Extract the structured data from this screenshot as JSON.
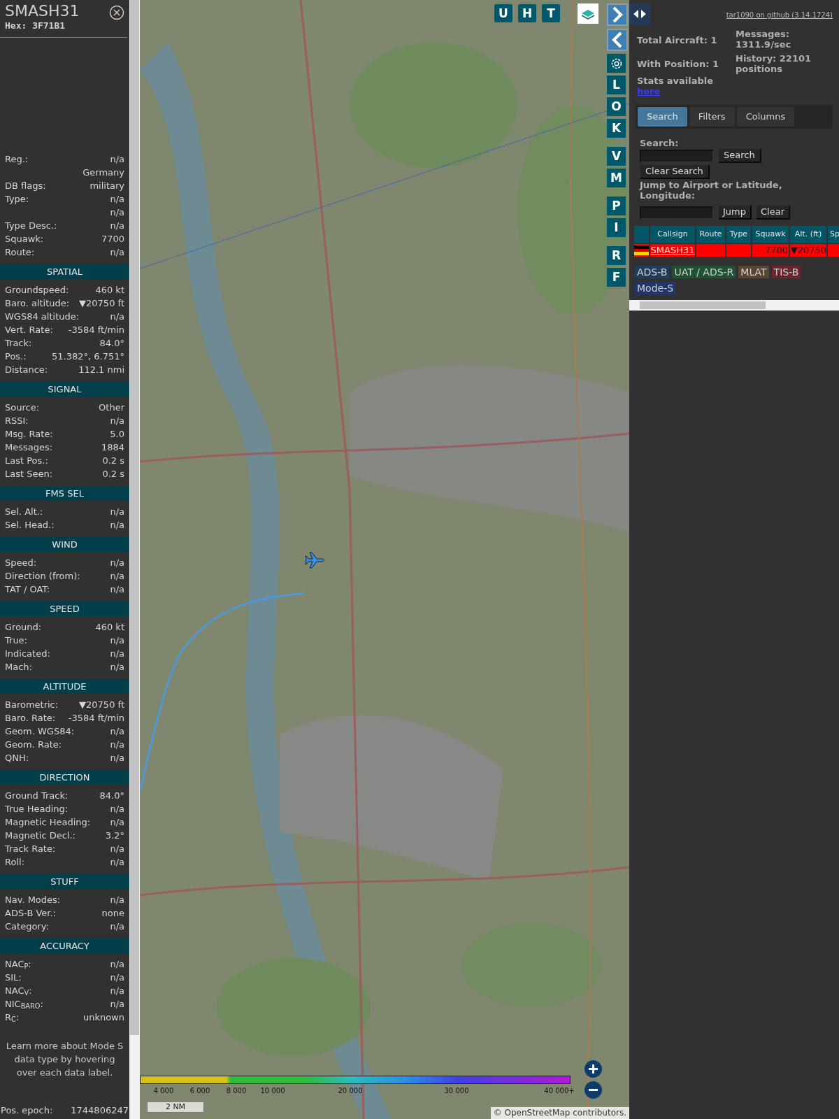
{
  "sidebar": {
    "title": "SMASH31",
    "hex": "Hex: 3F71B1",
    "sections": [
      {
        "rows": [
          {
            "label": "Reg.:",
            "value": "n/a"
          },
          {
            "value": "Germany"
          },
          {
            "label": "DB flags:",
            "value": "military"
          },
          {
            "label": "Type:",
            "value": "n/a"
          },
          {
            "value": "n/a"
          },
          {
            "label": "Type Desc.:",
            "value": "n/a"
          },
          {
            "label": "Squawk:",
            "value": "7700"
          },
          {
            "label": "Route:",
            "value": "n/a"
          }
        ]
      },
      {
        "heading": "SPATIAL",
        "rows": [
          {
            "label": "Groundspeed:",
            "value": "460 kt"
          },
          {
            "label": "Baro. altitude:",
            "value": "▼20750 ft"
          },
          {
            "label": "WGS84 altitude:",
            "value": "n/a"
          },
          {
            "label": "Vert. Rate:",
            "value": "-3584 ft/min"
          },
          {
            "label": "Track:",
            "value": "84.0°"
          },
          {
            "label": "Pos.:",
            "value": "51.382°, 6.751°"
          },
          {
            "label": "Distance:",
            "value": "112.1 nmi"
          }
        ]
      },
      {
        "heading": "SIGNAL",
        "rows": [
          {
            "label": "Source:",
            "value": "Other"
          },
          {
            "label": "RSSI:",
            "value": "n/a"
          },
          {
            "label": "Msg. Rate:",
            "value": "5.0"
          },
          {
            "label": "Messages:",
            "value": "1884"
          },
          {
            "label": "Last Pos.:",
            "value": "0.2 s"
          },
          {
            "label": "Last Seen:",
            "value": "0.2 s"
          }
        ]
      },
      {
        "heading": "FMS SEL",
        "rows": [
          {
            "label": "Sel. Alt.:",
            "value": "n/a"
          },
          {
            "label": "Sel. Head.:",
            "value": "n/a"
          }
        ]
      },
      {
        "heading": "WIND",
        "rows": [
          {
            "label": "Speed:",
            "value": "n/a"
          },
          {
            "label": "Direction (from):",
            "value": "n/a"
          },
          {
            "label": "TAT / OAT:",
            "value": "n/a"
          }
        ]
      },
      {
        "heading": "SPEED",
        "rows": [
          {
            "label": "Ground:",
            "value": "460 kt"
          },
          {
            "label": "True:",
            "value": "n/a"
          },
          {
            "label": "Indicated:",
            "value": "n/a"
          },
          {
            "label": "Mach:",
            "value": "n/a"
          }
        ]
      },
      {
        "heading": "ALTITUDE",
        "rows": [
          {
            "label": "Barometric:",
            "value": "▼20750 ft"
          },
          {
            "label": "Baro. Rate:",
            "value": "-3584 ft/min"
          },
          {
            "label": "Geom. WGS84:",
            "value": "n/a"
          },
          {
            "label": "Geom. Rate:",
            "value": "n/a"
          },
          {
            "label": "QNH:",
            "value": "n/a"
          }
        ]
      },
      {
        "heading": "DIRECTION",
        "rows": [
          {
            "label": "Ground Track:",
            "value": "84.0°"
          },
          {
            "label": "True Heading:",
            "value": "n/a"
          },
          {
            "label": "Magnetic Heading:",
            "value": "n/a"
          },
          {
            "label": "Magnetic Decl.:",
            "value": "3.2°"
          },
          {
            "label": "Track Rate:",
            "value": "n/a"
          },
          {
            "label": "Roll:",
            "value": "n/a"
          }
        ]
      },
      {
        "heading": "STUFF",
        "rows": [
          {
            "label": "Nav. Modes:",
            "value": "n/a"
          },
          {
            "label": "ADS-B Ver.:",
            "value": "none"
          },
          {
            "label": "Category:",
            "value": "n/a"
          }
        ]
      },
      {
        "heading": "ACCURACY",
        "rows": [
          {
            "label": "NAC$_{P}$:",
            "value": "n/a"
          },
          {
            "label": "SIL:",
            "value": "n/a"
          },
          {
            "label": "NAC$_{V}$:",
            "value": "n/a"
          },
          {
            "label": "NIC$_{BARO}$:",
            "value": "n/a"
          },
          {
            "label": "R$_{C}$:",
            "value": "unknown"
          }
        ]
      }
    ],
    "footnote": "Learn more about Mode S data type by hovering over each data label.",
    "epoch": {
      "label": "Pos. epoch:",
      "value": "1744806247"
    }
  },
  "map": {
    "top_buttons": [
      "U",
      "H",
      "T"
    ],
    "side_buttons": [
      {
        "kind": "next"
      },
      {
        "kind": "prev"
      },
      {
        "kind": "settings"
      },
      {
        "kind": "letter",
        "label": "L"
      },
      {
        "kind": "letter",
        "label": "O"
      },
      {
        "kind": "letter",
        "label": "K"
      },
      {
        "kind": "letter",
        "label": "V"
      },
      {
        "kind": "letter",
        "label": "M"
      },
      {
        "kind": "letter",
        "label": "P"
      },
      {
        "kind": "letter",
        "label": "I"
      },
      {
        "kind": "letter",
        "label": "R"
      },
      {
        "kind": "letter",
        "label": "F"
      }
    ],
    "legend": [
      "4 000",
      "6 000",
      "8 000",
      "10 000",
      "20 000",
      "30 000",
      "40 000+"
    ],
    "scale": "2 NM",
    "attribution": "© OpenStreetMap contributors."
  },
  "panel": {
    "github_link": "tar1090 on github (3.14.1724)",
    "stats": {
      "total": "Total Aircraft: 1",
      "with_position": "With Position: 1",
      "stats_label": "Stats available",
      "stats_link": "here",
      "messages": "Messages: 1311.9/sec",
      "history": "History: 22101 positions"
    },
    "tabs": [
      {
        "label": "Search",
        "selected": true
      },
      {
        "label": "Filters",
        "selected": false
      },
      {
        "label": "Columns",
        "selected": false
      }
    ],
    "search": {
      "label": "Search:",
      "button": "Search",
      "clear_button": "Clear Search"
    },
    "jump": {
      "label": "Jump to Airport or Latitude, Longitude:",
      "buttons": [
        "Jump",
        "Clear"
      ]
    },
    "table": {
      "columns": [
        "Callsign",
        "Route",
        "Type",
        "Squawk",
        "Alt. (ft)",
        "Sp"
      ],
      "rows": [
        {
          "callsign": "SMASH31",
          "squawk": "7700",
          "altitude": "▼20750",
          "emergency": true
        }
      ]
    },
    "sources": [
      {
        "label": "ADS-B",
        "color": "#1f3c5c"
      },
      {
        "label": "UAT / ADS-R",
        "color": "#1f5233"
      },
      {
        "label": "MLAT",
        "color": "#5a4530"
      },
      {
        "label": "TIS-B",
        "color": "#6a2531"
      },
      {
        "label": "Mode-S",
        "color": "#20356a"
      }
    ]
  }
}
